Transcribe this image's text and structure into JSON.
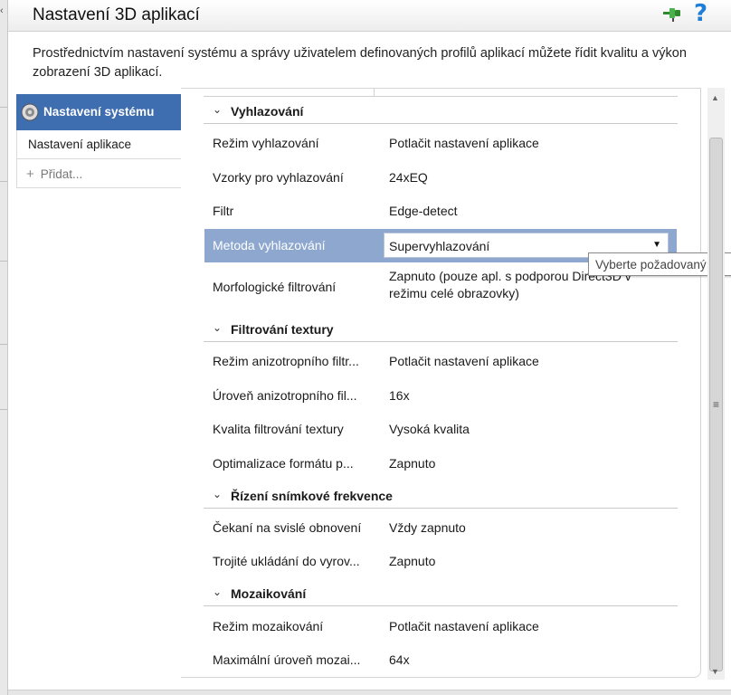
{
  "window": {
    "title": "Nastavení 3D aplikací",
    "description": "Prostřednictvím nastavení systému a správy uživatelem definovaných profilů aplikací můžete řídit kvalitu a výkon zobrazení 3D aplikací."
  },
  "icons": {
    "pin": "pin-icon",
    "help": "?",
    "gear": "gear-icon"
  },
  "colors": {
    "accent": "#3e6db0",
    "selected_row": "#8da7cf",
    "help": "#1f7fd8"
  },
  "nav": {
    "active": "Nastavení systému",
    "item_app": "Nastavení aplikace",
    "add": "Přidat..."
  },
  "sections": {
    "aa": {
      "title": "Vyhlazování",
      "rows": [
        {
          "label": "Režim vyhlazování",
          "value": "Potlačit nastavení aplikace"
        },
        {
          "label": "Vzorky pro vyhlazování",
          "value": "24xEQ"
        },
        {
          "label": "Filtr",
          "value": "Edge-detect"
        },
        {
          "label": "Metoda vyhlazování",
          "value": "Supervyhlazování"
        },
        {
          "label": "Morfologické filtrování",
          "value": "Zapnuto (pouze apl. s podporou Direct3D v režimu celé obrazovky)"
        }
      ]
    },
    "tex": {
      "title": "Filtrování textury",
      "rows": [
        {
          "label": "Režim anizotropního filtr...",
          "value": "Potlačit nastavení aplikace"
        },
        {
          "label": "Úroveň anizotropního fil...",
          "value": "16x"
        },
        {
          "label": "Kvalita filtrování textury",
          "value": "Vysoká kvalita"
        },
        {
          "label": "Optimalizace formátu p...",
          "value": "Zapnuto"
        }
      ]
    },
    "fps": {
      "title": "Řízení snímkové frekvence",
      "rows": [
        {
          "label": "Čekaní na svislé obnovení",
          "value": "Vždy zapnuto"
        },
        {
          "label": "Trojité ukládání do vyrov...",
          "value": "Zapnuto"
        }
      ]
    },
    "tess": {
      "title": "Mozaikování",
      "rows": [
        {
          "label": "Režim mozaikování",
          "value": "Potlačit nastavení aplikace"
        },
        {
          "label": "Maximální úroveň mozai...",
          "value": "64x"
        }
      ]
    }
  },
  "tooltip": "Vyberte požadovaný re"
}
